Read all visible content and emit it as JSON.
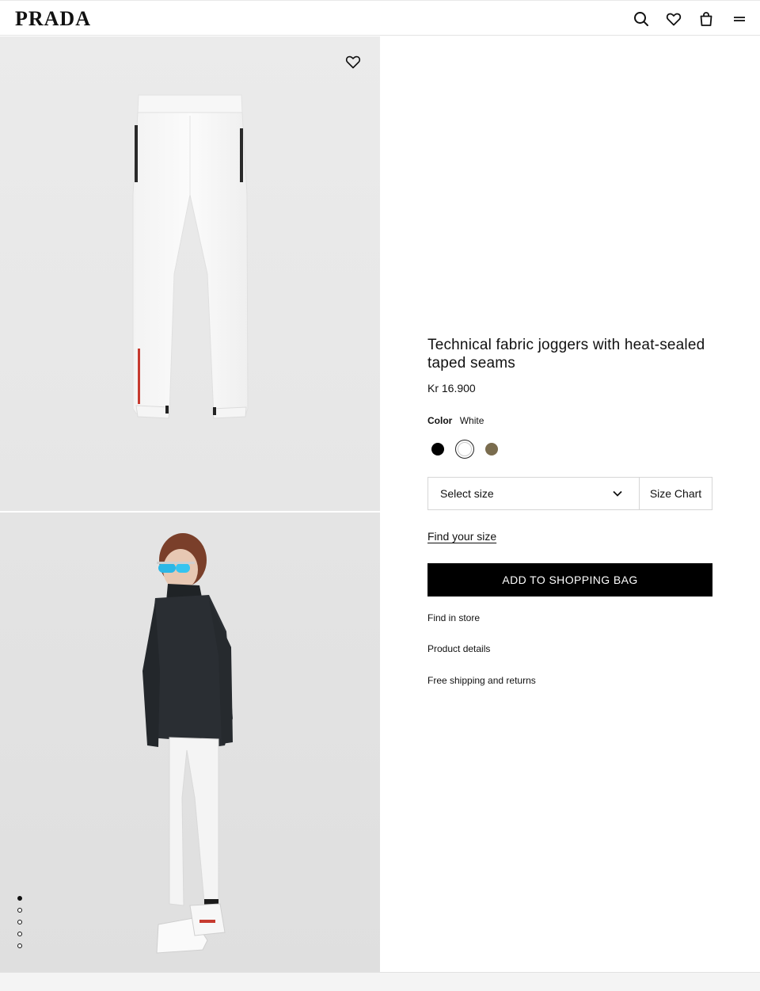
{
  "header": {
    "logo": "PRADA",
    "icons": [
      "search-icon",
      "heart-icon",
      "bag-icon",
      "menu-icon"
    ]
  },
  "gallery": {
    "slides_total": 5,
    "active_slide": 1
  },
  "product": {
    "title": "Technical fabric joggers with heat-sealed taped seams",
    "price": "Kr 16.900",
    "color_label": "Color",
    "color_value": "White",
    "swatches": [
      {
        "name": "Black",
        "hex": "#000000"
      },
      {
        "name": "White",
        "hex": "#ffffff",
        "selected": true
      },
      {
        "name": "Olive",
        "hex": "#7a6c4e"
      }
    ],
    "size_placeholder": "Select size",
    "size_chart": "Size Chart",
    "find_size": "Find your size",
    "add_to_bag": "ADD TO SHOPPING BAG",
    "find_in_store": "Find in store",
    "product_details": "Product details",
    "shipping": "Free shipping and returns"
  },
  "colors": {
    "button_bg": "#000000",
    "image_bg": "#e9e9e9"
  }
}
